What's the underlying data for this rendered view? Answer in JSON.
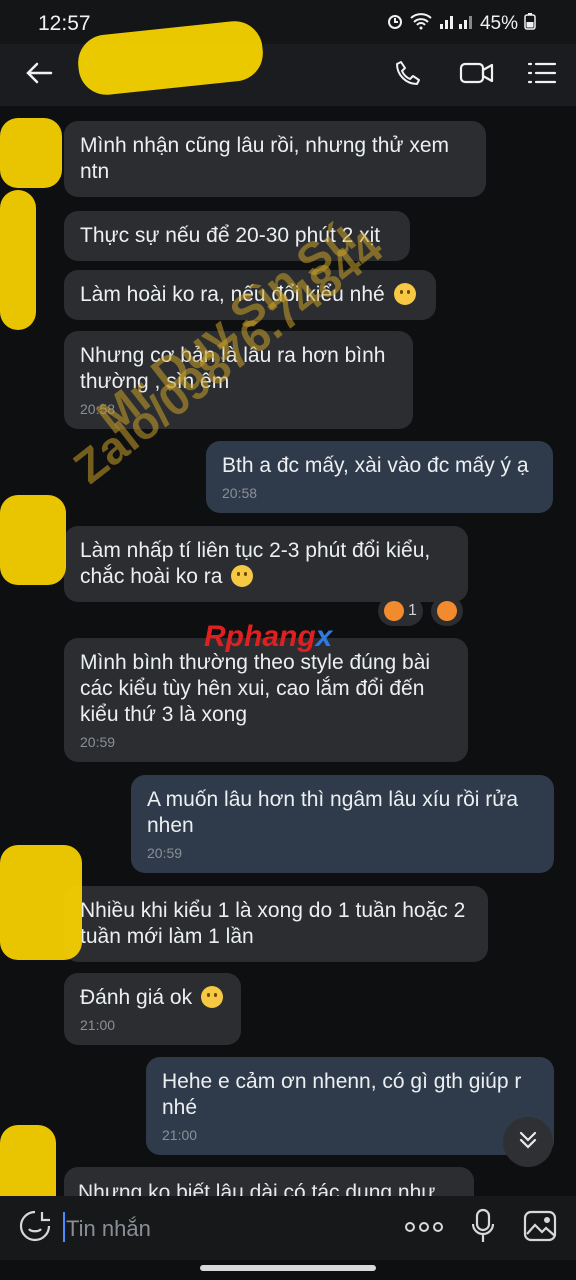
{
  "status": {
    "time": "12:57",
    "battery": "45%"
  },
  "messages": [
    {
      "id": "m1",
      "dir": "in",
      "text": "Mình nhận cũng lâu rồi, nhưng thử xem ntn"
    },
    {
      "id": "m2",
      "dir": "in",
      "text": "Thực sự nếu để 20-30 phút 2 xịt"
    },
    {
      "id": "m3",
      "dir": "in",
      "text": "Làm hoài ko ra, nếu đổi kiểu nhé"
    },
    {
      "id": "m4",
      "dir": "in",
      "text": "Nhưng cơ bản là lâu ra hơn bình thường , sìn êm",
      "time": "20:58"
    },
    {
      "id": "m5",
      "dir": "out",
      "text": "Bth a đc mấy, xài vào đc mấy ý ạ",
      "time": "20:58"
    },
    {
      "id": "m6",
      "dir": "in",
      "text": "Làm nhấp tí liên tục 2-3 phút đổi kiểu, chắc hoài ko ra"
    },
    {
      "id": "m7",
      "dir": "in",
      "text": "Mình bình thường theo style đúng bài các kiểu tùy hên xui, cao lắm đổi đến kiểu thứ 3 là xong",
      "time": "20:59"
    },
    {
      "id": "m8",
      "dir": "out",
      "text": "A muốn lâu hơn thì ngâm lâu xíu rồi rửa nhen",
      "time": "20:59"
    },
    {
      "id": "m9",
      "dir": "in",
      "text": "Nhiều khi kiểu 1 là xong do 1 tuần hoặc 2 tuần mới làm 1 lần"
    },
    {
      "id": "m10",
      "dir": "in",
      "text": "Đánh giá ok",
      "time": "21:00"
    },
    {
      "id": "m11",
      "dir": "out",
      "text": "Hehe e cảm ơn nhenn, có gì gth giúp r nhé",
      "time": "21:00"
    },
    {
      "id": "m12",
      "dir": "in",
      "text": "Nhưng ko biết lâu dài có tác dụng như"
    }
  ],
  "reactions": {
    "count": "1"
  },
  "watermark": {
    "line1": "Mr Duy Sìn Sú",
    "line2": "Zalo/09876.74844"
  },
  "logo": {
    "part1": "Rphang",
    "part2": "x"
  },
  "input": {
    "placeholder": "Tin nhắn"
  },
  "colors": {
    "incoming": "#2b2d31",
    "outgoing": "#2f3b4b",
    "highlight": "#f4d000"
  }
}
